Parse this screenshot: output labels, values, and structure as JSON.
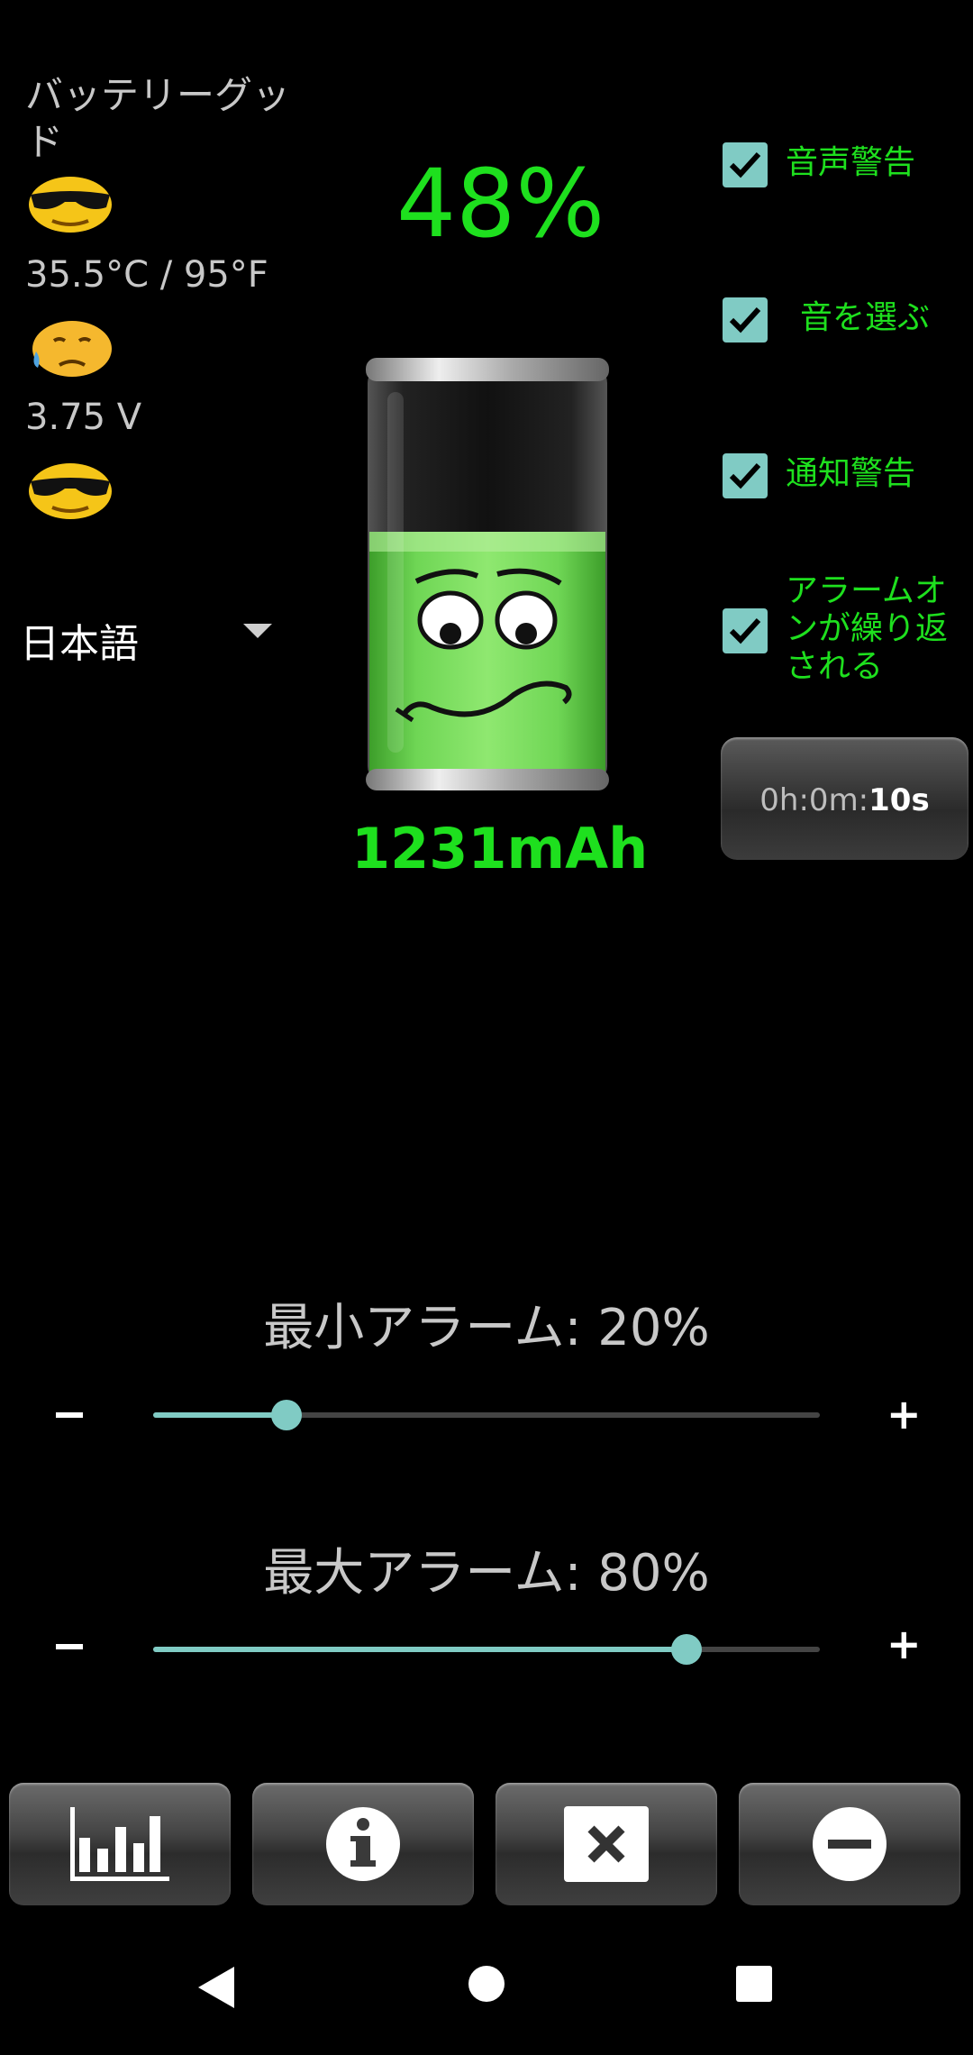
{
  "status": {
    "title": "バッテリーグッド",
    "temperature": "35.5°C / 95°F",
    "voltage": "3.75 V"
  },
  "language": {
    "selected": "日本語"
  },
  "battery": {
    "percent_text": "48%",
    "level": 0.48,
    "capacity": "1231mAh"
  },
  "options": [
    {
      "label": "音声警告",
      "checked": true
    },
    {
      "label": "音を選ぶ",
      "checked": true
    },
    {
      "label": "通知警告",
      "checked": true
    },
    {
      "label": "アラームオンが繰り返される",
      "checked": true
    }
  ],
  "timer": {
    "prefix": "0h:0m:",
    "seconds": "10s"
  },
  "alarms": {
    "min": {
      "label": "最小アラーム: 20%",
      "value": 20,
      "minus": "−",
      "plus": "+"
    },
    "max": {
      "label": "最大アラーム: 80%",
      "value": 80,
      "minus": "−",
      "plus": "+"
    }
  },
  "bottom_buttons": [
    "chart-icon",
    "info-icon",
    "close-icon",
    "minus-icon"
  ],
  "nav": [
    "back-icon",
    "home-icon",
    "recents-icon"
  ],
  "colors": {
    "accent_green": "#1ee01e",
    "teal": "#80cbc4",
    "background": "#000000"
  }
}
